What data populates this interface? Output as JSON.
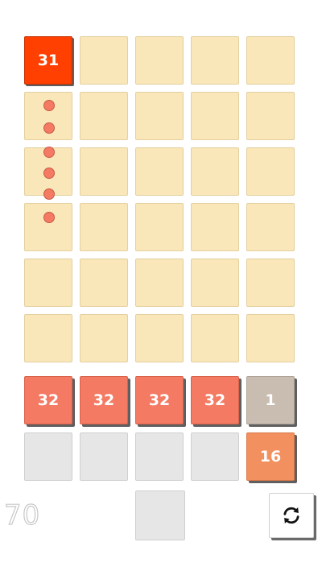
{
  "board": {
    "active_tile": {
      "value": "31",
      "color": "#ff4000"
    },
    "tray_tiles": [
      {
        "value": "32",
        "color": "#f47a63"
      },
      {
        "value": "32",
        "color": "#f47a63"
      },
      {
        "value": "32",
        "color": "#f47a63"
      },
      {
        "value": "32",
        "color": "#f47a63"
      },
      {
        "value": "1",
        "color": "#c9bcb0"
      }
    ],
    "side_tile": {
      "value": "16",
      "color": "#f39060"
    }
  },
  "score": "70",
  "icons": {
    "refresh": "refresh-icon"
  },
  "colors": {
    "grid_cell": "#fae7b9",
    "empty_slot": "#e6e6e6",
    "trail_dot": "#f47a63"
  }
}
